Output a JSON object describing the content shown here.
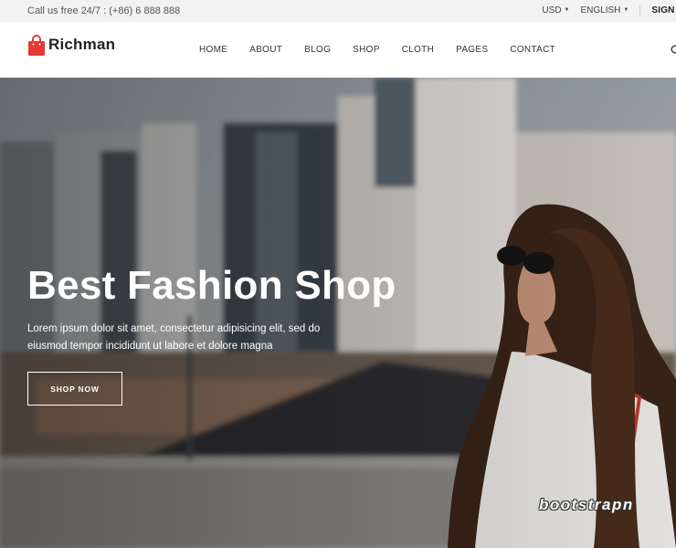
{
  "topbar": {
    "phone": "Call us free 24/7 : (+86) 6 888 888",
    "currency": "USD",
    "language": "ENGLISH",
    "signin": "SIGN IN"
  },
  "header": {
    "logo_text": "Richman",
    "nav": [
      "HOME",
      "ABOUT",
      "BLOG",
      "SHOP",
      "CLOTH",
      "PAGES",
      "CONTACT"
    ]
  },
  "hero": {
    "title": "Best Fashion Shop",
    "text": "Lorem ipsum dolor sit amet, consectetur adipisicing elit, sed do eiusmod tempor incididunt ut labore et dolore magna",
    "button": "SHOP NOW",
    "watermark": "bootstrapn"
  },
  "colors": {
    "brand_red": "#e53935",
    "topbar_bg": "#f2f2f2"
  },
  "icons": [
    "shopping-bag-icon",
    "search-icon",
    "caret-down-icon"
  ]
}
